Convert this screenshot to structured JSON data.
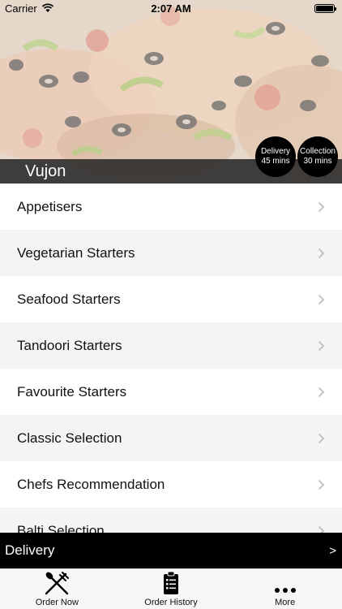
{
  "status_bar": {
    "carrier": "Carrier",
    "time": "2:07 AM"
  },
  "hero": {
    "restaurant_name": "Vujon",
    "delivery_badge": {
      "title": "Delivery",
      "time": "45 mins"
    },
    "collection_badge": {
      "title": "Collection",
      "time": "30 mins"
    }
  },
  "menu": {
    "items": [
      {
        "label": "Appetisers"
      },
      {
        "label": "Vegetarian Starters"
      },
      {
        "label": "Seafood Starters"
      },
      {
        "label": "Tandoori Starters"
      },
      {
        "label": "Favourite Starters"
      },
      {
        "label": "Classic Selection"
      },
      {
        "label": "Chefs Recommendation"
      },
      {
        "label": "Balti Selection"
      }
    ]
  },
  "delivery_bar": {
    "label": "Delivery",
    "arrow": ">"
  },
  "tab_bar": {
    "tabs": [
      {
        "label": "Order Now",
        "icon": "fork-knife-icon"
      },
      {
        "label": "Order History",
        "icon": "clipboard-list-icon"
      },
      {
        "label": "More",
        "icon": "more-dots-icon"
      }
    ]
  },
  "colors": {
    "bar": "#000000",
    "tab_bar": "#f6f6f6",
    "alt_row": "#f4f4f6"
  }
}
